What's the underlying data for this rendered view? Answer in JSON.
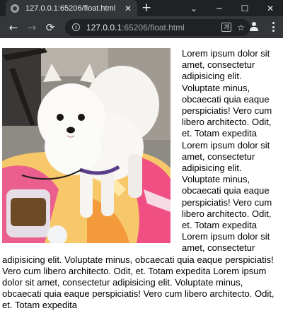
{
  "browser": {
    "tab_title": "127.0.0.1:65206/float.html",
    "tab_close_icon": "close-icon",
    "new_tab_label": "+",
    "window_controls": {
      "minimize": "⌄",
      "restore": "─",
      "maximize": "☐",
      "close": "✕"
    },
    "nav": {
      "back": "←",
      "forward": "→",
      "reload": "⟳"
    },
    "url_host": "127.0.0.1",
    "url_rest": ":65206/float.html",
    "bookmark_star": "☆"
  },
  "page": {
    "image_alt_icon": "dog-photo",
    "paragraph": "Lorem ipsum dolor sit amet, consectetur adipisicing elit. Voluptate minus, obcaecati quia eaque perspiciatis! Vero cum libero architecto. Odit, et. Totam expedita Lorem ipsum dolor sit amet, consectetur adipisicing elit. Voluptate minus, obcaecati quia eaque perspiciatis! Vero cum libero architecto. Odit, et. Totam expedita Lorem ipsum dolor sit amet, consectetur adipisicing elit. Voluptate minus, obcaecati quia eaque perspiciatis! Vero cum libero architecto. Odit, et. Totam expedita Lorem ipsum dolor sit amet, consectetur adipisicing elit. Voluptate minus, obcaecati quia eaque perspiciatis! Vero cum libero architecto. Odit, et. Totam expedita"
  },
  "colors": {
    "tabstrip_bg": "#202124",
    "toolbar_bg": "#35363a",
    "omnibox_bg": "#202124",
    "chrome_text": "#e8eaed"
  }
}
